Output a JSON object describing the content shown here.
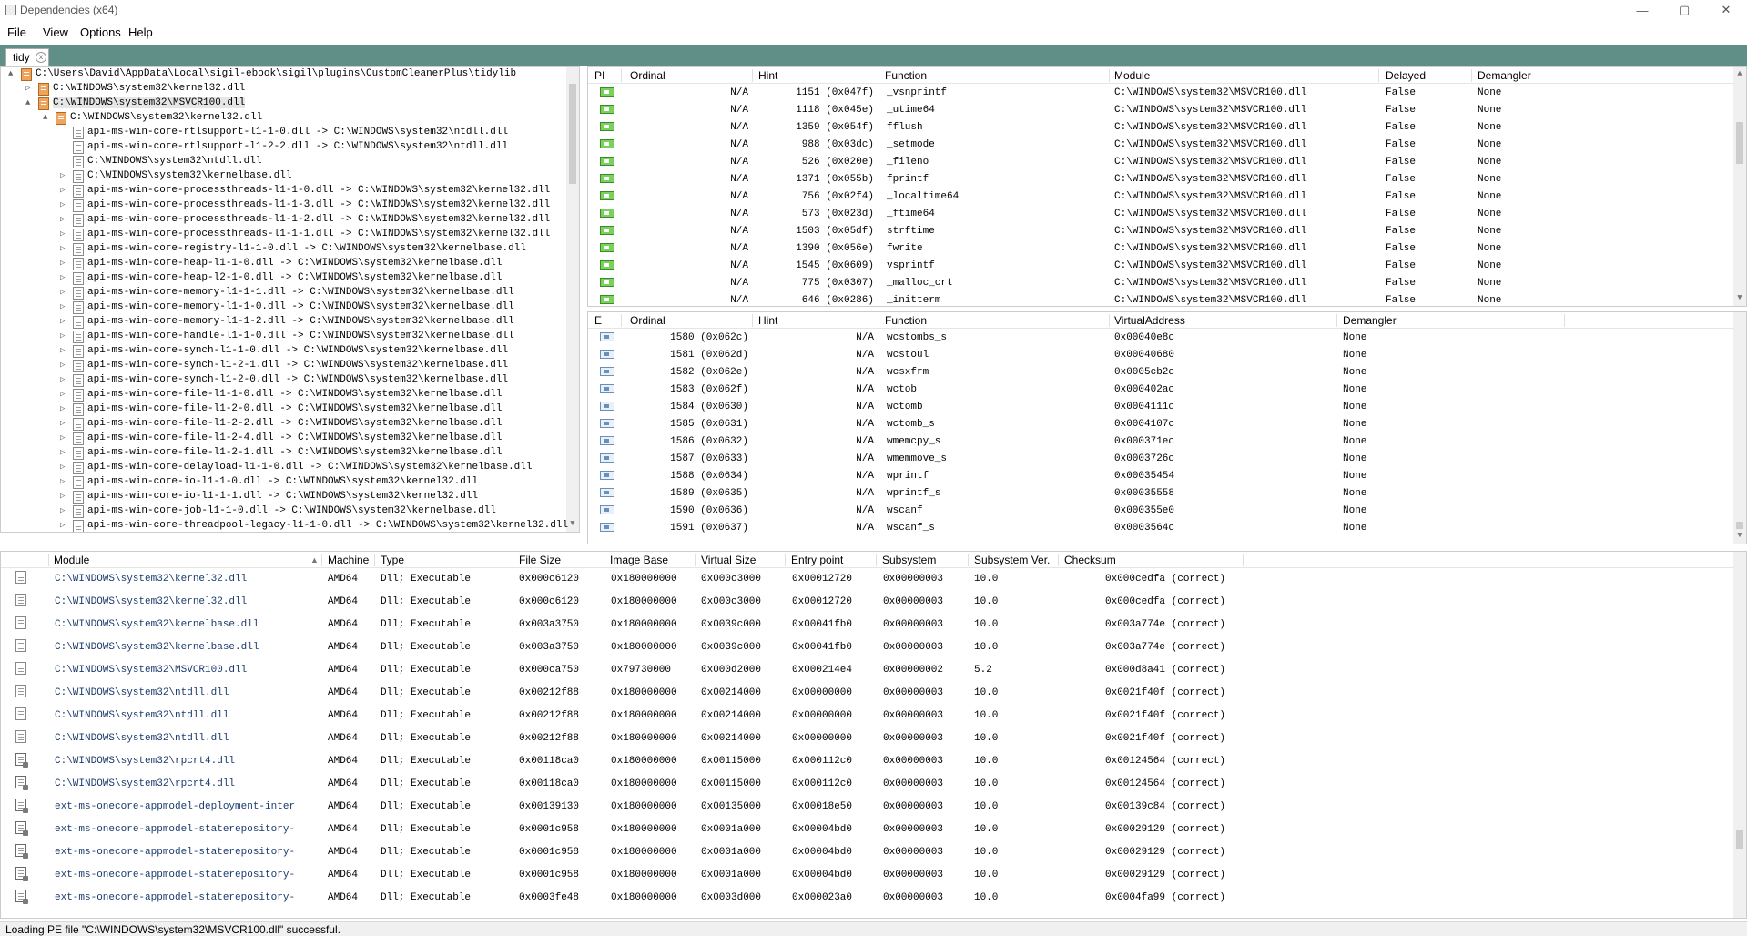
{
  "window": {
    "title": "Dependencies (x64)",
    "minimize": "—",
    "maximize": "▢",
    "close": "✕"
  },
  "menu": [
    "File",
    "View",
    "Options",
    "Help"
  ],
  "tab": {
    "label": "tidy",
    "close": "x"
  },
  "tree": [
    {
      "level": 0,
      "exp": "▲",
      "folder": true,
      "text": "C:\\Users\\David\\AppData\\Local\\sigil-ebook\\sigil\\plugins\\CustomCleanerPlus\\tidylib"
    },
    {
      "level": 1,
      "exp": "▷",
      "folder": true,
      "text": "C:\\WINDOWS\\system32\\kernel32.dll"
    },
    {
      "level": 1,
      "exp": "▲",
      "folder": true,
      "text": "C:\\WINDOWS\\system32\\MSVCR100.dll",
      "selected": true
    },
    {
      "level": 2,
      "exp": "▲",
      "folder": true,
      "text": "C:\\WINDOWS\\system32\\kernel32.dll"
    },
    {
      "level": 3,
      "exp": "",
      "folder": false,
      "text": "api-ms-win-core-rtlsupport-l1-1-0.dll -> C:\\WINDOWS\\system32\\ntdll.dll"
    },
    {
      "level": 3,
      "exp": "",
      "folder": false,
      "text": "api-ms-win-core-rtlsupport-l1-2-2.dll -> C:\\WINDOWS\\system32\\ntdll.dll"
    },
    {
      "level": 3,
      "exp": "",
      "folder": false,
      "text": "C:\\WINDOWS\\system32\\ntdll.dll"
    },
    {
      "level": 3,
      "exp": "▷",
      "folder": false,
      "text": "C:\\WINDOWS\\system32\\kernelbase.dll"
    },
    {
      "level": 3,
      "exp": "▷",
      "folder": false,
      "text": "api-ms-win-core-processthreads-l1-1-0.dll -> C:\\WINDOWS\\system32\\kernel32.dll"
    },
    {
      "level": 3,
      "exp": "▷",
      "folder": false,
      "text": "api-ms-win-core-processthreads-l1-1-3.dll -> C:\\WINDOWS\\system32\\kernel32.dll"
    },
    {
      "level": 3,
      "exp": "▷",
      "folder": false,
      "text": "api-ms-win-core-processthreads-l1-1-2.dll -> C:\\WINDOWS\\system32\\kernel32.dll"
    },
    {
      "level": 3,
      "exp": "▷",
      "folder": false,
      "text": "api-ms-win-core-processthreads-l1-1-1.dll -> C:\\WINDOWS\\system32\\kernel32.dll"
    },
    {
      "level": 3,
      "exp": "▷",
      "folder": false,
      "text": "api-ms-win-core-registry-l1-1-0.dll -> C:\\WINDOWS\\system32\\kernelbase.dll"
    },
    {
      "level": 3,
      "exp": "▷",
      "folder": false,
      "text": "api-ms-win-core-heap-l1-1-0.dll -> C:\\WINDOWS\\system32\\kernelbase.dll"
    },
    {
      "level": 3,
      "exp": "▷",
      "folder": false,
      "text": "api-ms-win-core-heap-l2-1-0.dll -> C:\\WINDOWS\\system32\\kernelbase.dll"
    },
    {
      "level": 3,
      "exp": "▷",
      "folder": false,
      "text": "api-ms-win-core-memory-l1-1-1.dll -> C:\\WINDOWS\\system32\\kernelbase.dll"
    },
    {
      "level": 3,
      "exp": "▷",
      "folder": false,
      "text": "api-ms-win-core-memory-l1-1-0.dll -> C:\\WINDOWS\\system32\\kernelbase.dll"
    },
    {
      "level": 3,
      "exp": "▷",
      "folder": false,
      "text": "api-ms-win-core-memory-l1-1-2.dll -> C:\\WINDOWS\\system32\\kernelbase.dll"
    },
    {
      "level": 3,
      "exp": "▷",
      "folder": false,
      "text": "api-ms-win-core-handle-l1-1-0.dll -> C:\\WINDOWS\\system32\\kernelbase.dll"
    },
    {
      "level": 3,
      "exp": "▷",
      "folder": false,
      "text": "api-ms-win-core-synch-l1-1-0.dll -> C:\\WINDOWS\\system32\\kernelbase.dll"
    },
    {
      "level": 3,
      "exp": "▷",
      "folder": false,
      "text": "api-ms-win-core-synch-l1-2-1.dll -> C:\\WINDOWS\\system32\\kernelbase.dll"
    },
    {
      "level": 3,
      "exp": "▷",
      "folder": false,
      "text": "api-ms-win-core-synch-l1-2-0.dll -> C:\\WINDOWS\\system32\\kernelbase.dll"
    },
    {
      "level": 3,
      "exp": "▷",
      "folder": false,
      "text": "api-ms-win-core-file-l1-1-0.dll -> C:\\WINDOWS\\system32\\kernelbase.dll"
    },
    {
      "level": 3,
      "exp": "▷",
      "folder": false,
      "text": "api-ms-win-core-file-l1-2-0.dll -> C:\\WINDOWS\\system32\\kernelbase.dll"
    },
    {
      "level": 3,
      "exp": "▷",
      "folder": false,
      "text": "api-ms-win-core-file-l1-2-2.dll -> C:\\WINDOWS\\system32\\kernelbase.dll"
    },
    {
      "level": 3,
      "exp": "▷",
      "folder": false,
      "text": "api-ms-win-core-file-l1-2-4.dll -> C:\\WINDOWS\\system32\\kernelbase.dll"
    },
    {
      "level": 3,
      "exp": "▷",
      "folder": false,
      "text": "api-ms-win-core-file-l1-2-1.dll -> C:\\WINDOWS\\system32\\kernelbase.dll"
    },
    {
      "level": 3,
      "exp": "▷",
      "folder": false,
      "text": "api-ms-win-core-delayload-l1-1-0.dll -> C:\\WINDOWS\\system32\\kernelbase.dll"
    },
    {
      "level": 3,
      "exp": "▷",
      "folder": false,
      "text": "api-ms-win-core-io-l1-1-0.dll -> C:\\WINDOWS\\system32\\kernel32.dll"
    },
    {
      "level": 3,
      "exp": "▷",
      "folder": false,
      "text": "api-ms-win-core-io-l1-1-1.dll -> C:\\WINDOWS\\system32\\kernel32.dll"
    },
    {
      "level": 3,
      "exp": "▷",
      "folder": false,
      "text": "api-ms-win-core-job-l1-1-0.dll -> C:\\WINDOWS\\system32\\kernelbase.dll"
    },
    {
      "level": 3,
      "exp": "▷",
      "folder": false,
      "text": "api-ms-win-core-threadpool-legacy-l1-1-0.dll -> C:\\WINDOWS\\system32\\kernel32.dll"
    }
  ],
  "imports": {
    "headers": [
      "PI",
      "Ordinal",
      "Hint",
      "Function",
      "Module",
      "Delayed",
      "Demangler"
    ],
    "rows": [
      [
        "N/A",
        "1151 (0x047f)",
        "_vsnprintf",
        "C:\\WINDOWS\\system32\\MSVCR100.dll",
        "False",
        "None"
      ],
      [
        "N/A",
        "1118 (0x045e)",
        "_utime64",
        "C:\\WINDOWS\\system32\\MSVCR100.dll",
        "False",
        "None"
      ],
      [
        "N/A",
        "1359 (0x054f)",
        "fflush",
        "C:\\WINDOWS\\system32\\MSVCR100.dll",
        "False",
        "None"
      ],
      [
        "N/A",
        "988 (0x03dc)",
        "_setmode",
        "C:\\WINDOWS\\system32\\MSVCR100.dll",
        "False",
        "None"
      ],
      [
        "N/A",
        "526 (0x020e)",
        "_fileno",
        "C:\\WINDOWS\\system32\\MSVCR100.dll",
        "False",
        "None"
      ],
      [
        "N/A",
        "1371 (0x055b)",
        "fprintf",
        "C:\\WINDOWS\\system32\\MSVCR100.dll",
        "False",
        "None"
      ],
      [
        "N/A",
        "756 (0x02f4)",
        "_localtime64",
        "C:\\WINDOWS\\system32\\MSVCR100.dll",
        "False",
        "None"
      ],
      [
        "N/A",
        "573 (0x023d)",
        "_ftime64",
        "C:\\WINDOWS\\system32\\MSVCR100.dll",
        "False",
        "None"
      ],
      [
        "N/A",
        "1503 (0x05df)",
        "strftime",
        "C:\\WINDOWS\\system32\\MSVCR100.dll",
        "False",
        "None"
      ],
      [
        "N/A",
        "1390 (0x056e)",
        "fwrite",
        "C:\\WINDOWS\\system32\\MSVCR100.dll",
        "False",
        "None"
      ],
      [
        "N/A",
        "1545 (0x0609)",
        "vsprintf",
        "C:\\WINDOWS\\system32\\MSVCR100.dll",
        "False",
        "None"
      ],
      [
        "N/A",
        "775 (0x0307)",
        "_malloc_crt",
        "C:\\WINDOWS\\system32\\MSVCR100.dll",
        "False",
        "None"
      ],
      [
        "N/A",
        "646 (0x0286)",
        "_initterm",
        "C:\\WINDOWS\\system32\\MSVCR100.dll",
        "False",
        "None"
      ]
    ]
  },
  "exports": {
    "headers": [
      "E",
      "Ordinal",
      "Hint",
      "Function",
      "VirtualAddress",
      "Demangler"
    ],
    "rows": [
      [
        "1580 (0x062c)",
        "N/A",
        "wcstombs_s",
        "0x00040e8c",
        "None"
      ],
      [
        "1581 (0x062d)",
        "N/A",
        "wcstoul",
        "0x00040680",
        "None"
      ],
      [
        "1582 (0x062e)",
        "N/A",
        "wcsxfrm",
        "0x0005cb2c",
        "None"
      ],
      [
        "1583 (0x062f)",
        "N/A",
        "wctob",
        "0x000402ac",
        "None"
      ],
      [
        "1584 (0x0630)",
        "N/A",
        "wctomb",
        "0x0004111c",
        "None"
      ],
      [
        "1585 (0x0631)",
        "N/A",
        "wctomb_s",
        "0x0004107c",
        "None"
      ],
      [
        "1586 (0x0632)",
        "N/A",
        "wmemcpy_s",
        "0x000371ec",
        "None"
      ],
      [
        "1587 (0x0633)",
        "N/A",
        "wmemmove_s",
        "0x0003726c",
        "None"
      ],
      [
        "1588 (0x0634)",
        "N/A",
        "wprintf",
        "0x00035454",
        "None"
      ],
      [
        "1589 (0x0635)",
        "N/A",
        "wprintf_s",
        "0x00035558",
        "None"
      ],
      [
        "1590 (0x0636)",
        "N/A",
        "wscanf",
        "0x000355e0",
        "None"
      ],
      [
        "1591 (0x0637)",
        "N/A",
        "wscanf_s",
        "0x0003564c",
        "None"
      ]
    ]
  },
  "modules": {
    "headers": [
      "Module",
      "Machine",
      "Type",
      "File Size",
      "Image Base",
      "Virtual Size",
      "Entry point",
      "Subsystem",
      "Subsystem Ver.",
      "Checksum"
    ],
    "sort_indicator": "▲",
    "rows": [
      [
        "C:\\WINDOWS\\system32\\kernel32.dll",
        "AMD64",
        "Dll; Executable",
        "0x000c6120",
        "0x180000000",
        "0x000c3000",
        "0x00012720",
        "0x00000003",
        "10.0",
        "0x000cedfa (correct)"
      ],
      [
        "C:\\WINDOWS\\system32\\kernel32.dll",
        "AMD64",
        "Dll; Executable",
        "0x000c6120",
        "0x180000000",
        "0x000c3000",
        "0x00012720",
        "0x00000003",
        "10.0",
        "0x000cedfa (correct)"
      ],
      [
        "C:\\WINDOWS\\system32\\kernelbase.dll",
        "AMD64",
        "Dll; Executable",
        "0x003a3750",
        "0x180000000",
        "0x0039c000",
        "0x00041fb0",
        "0x00000003",
        "10.0",
        "0x003a774e (correct)"
      ],
      [
        "C:\\WINDOWS\\system32\\kernelbase.dll",
        "AMD64",
        "Dll; Executable",
        "0x003a3750",
        "0x180000000",
        "0x0039c000",
        "0x00041fb0",
        "0x00000003",
        "10.0",
        "0x003a774e (correct)"
      ],
      [
        "C:\\WINDOWS\\system32\\MSVCR100.dll",
        "AMD64",
        "Dll; Executable",
        "0x000ca750",
        "0x79730000",
        "0x000d2000",
        "0x000214e4",
        "0x00000002",
        "5.2",
        "0x000d8a41 (correct)"
      ],
      [
        "C:\\WINDOWS\\system32\\ntdll.dll",
        "AMD64",
        "Dll; Executable",
        "0x00212f88",
        "0x180000000",
        "0x00214000",
        "0x00000000",
        "0x00000003",
        "10.0",
        "0x0021f40f (correct)"
      ],
      [
        "C:\\WINDOWS\\system32\\ntdll.dll",
        "AMD64",
        "Dll; Executable",
        "0x00212f88",
        "0x180000000",
        "0x00214000",
        "0x00000000",
        "0x00000003",
        "10.0",
        "0x0021f40f (correct)"
      ],
      [
        "C:\\WINDOWS\\system32\\ntdll.dll",
        "AMD64",
        "Dll; Executable",
        "0x00212f88",
        "0x180000000",
        "0x00214000",
        "0x00000000",
        "0x00000003",
        "10.0",
        "0x0021f40f (correct)"
      ],
      [
        "C:\\WINDOWS\\system32\\rpcrt4.dll",
        "AMD64",
        "Dll; Executable",
        "0x00118ca0",
        "0x180000000",
        "0x00115000",
        "0x000112c0",
        "0x00000003",
        "10.0",
        "0x00124564 (correct)"
      ],
      [
        "C:\\WINDOWS\\system32\\rpcrt4.dll",
        "AMD64",
        "Dll; Executable",
        "0x00118ca0",
        "0x180000000",
        "0x00115000",
        "0x000112c0",
        "0x00000003",
        "10.0",
        "0x00124564 (correct)"
      ],
      [
        "ext-ms-onecore-appmodel-deployment-inter",
        "AMD64",
        "Dll; Executable",
        "0x00139130",
        "0x180000000",
        "0x00135000",
        "0x00018e50",
        "0x00000003",
        "10.0",
        "0x00139c84 (correct)"
      ],
      [
        "ext-ms-onecore-appmodel-staterepository-",
        "AMD64",
        "Dll; Executable",
        "0x0001c958",
        "0x180000000",
        "0x0001a000",
        "0x00004bd0",
        "0x00000003",
        "10.0",
        "0x00029129 (correct)"
      ],
      [
        "ext-ms-onecore-appmodel-staterepository-",
        "AMD64",
        "Dll; Executable",
        "0x0001c958",
        "0x180000000",
        "0x0001a000",
        "0x00004bd0",
        "0x00000003",
        "10.0",
        "0x00029129 (correct)"
      ],
      [
        "ext-ms-onecore-appmodel-staterepository-",
        "AMD64",
        "Dll; Executable",
        "0x0001c958",
        "0x180000000",
        "0x0001a000",
        "0x00004bd0",
        "0x00000003",
        "10.0",
        "0x00029129 (correct)"
      ],
      [
        "ext-ms-onecore-appmodel-staterepository-",
        "AMD64",
        "Dll; Executable",
        "0x0003fe48",
        "0x180000000",
        "0x0003d000",
        "0x000023a0",
        "0x00000003",
        "10.0",
        "0x0004fa99 (correct)"
      ]
    ]
  },
  "status": "Loading PE file \"C:\\WINDOWS\\system32\\MSVCR100.dll\" successful."
}
